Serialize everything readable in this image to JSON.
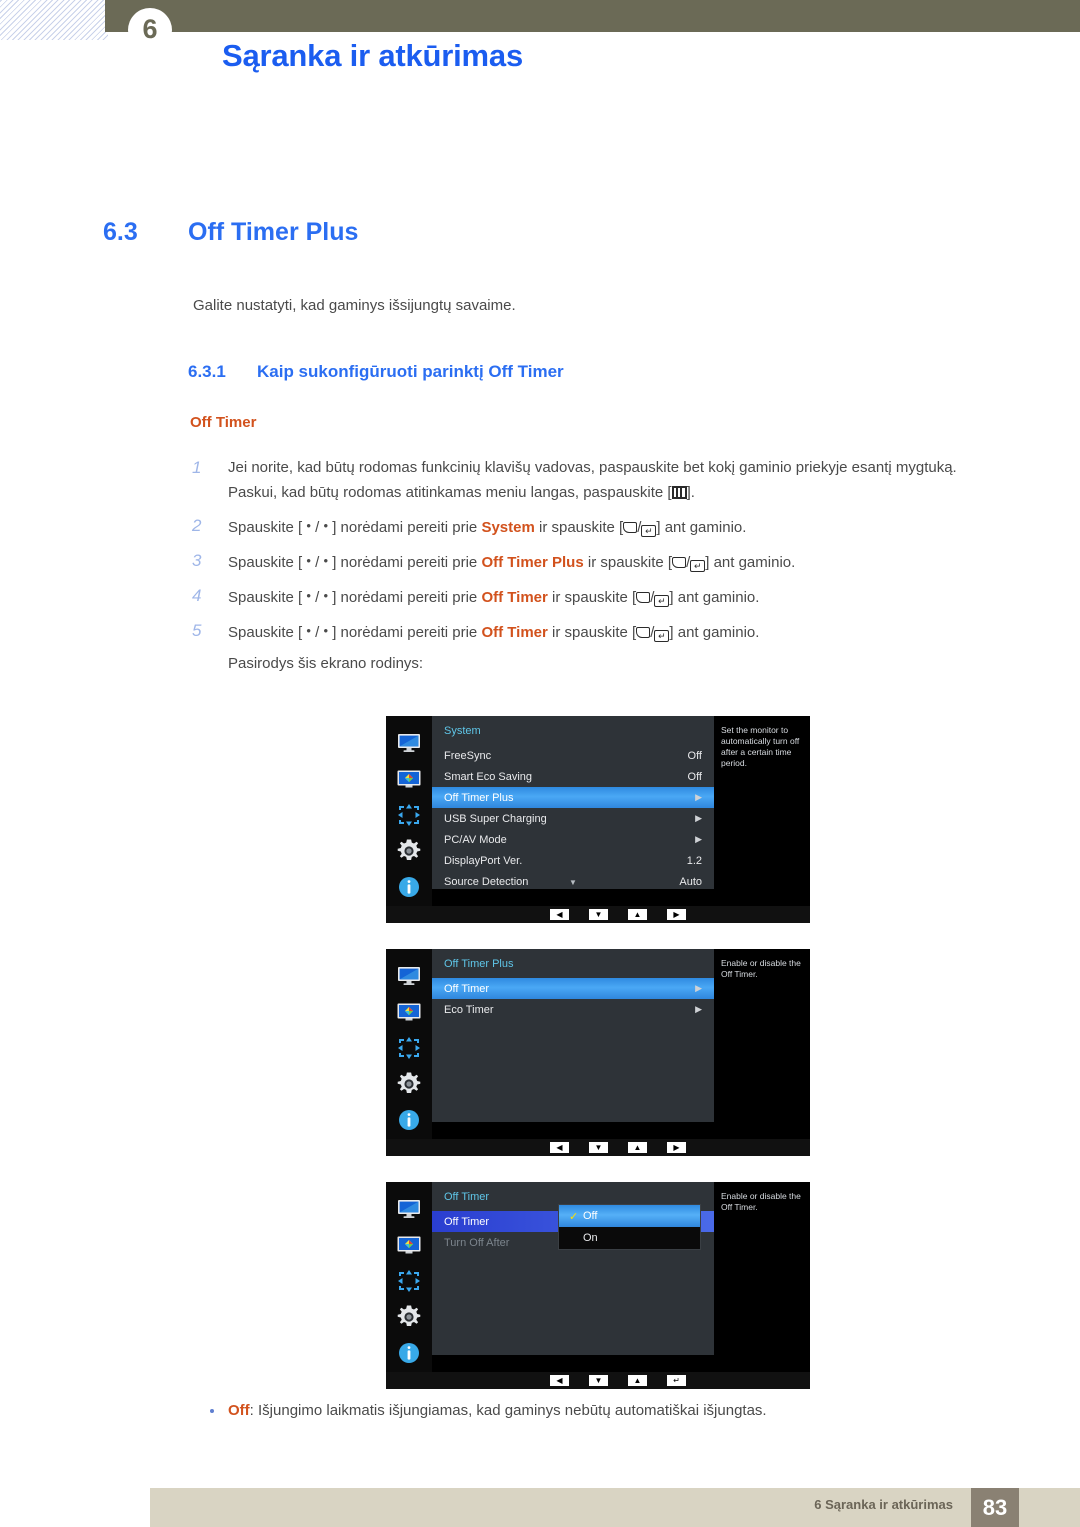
{
  "header": {
    "chapter_number": "6",
    "title": "Sąranka ir atkūrimas"
  },
  "section": {
    "number": "6.3",
    "title": "Off Timer Plus",
    "lead": "Galite nustatyti, kad gaminys išsijungtų savaime."
  },
  "subsection": {
    "number": "6.3.1",
    "title": "Kaip sukonfigūruoti parinktį Off Timer",
    "orange_label": "Off Timer"
  },
  "steps": [
    {
      "num": "1",
      "segments": [
        {
          "t": "Jei norite, kad būtų rodomas funkcinių klavišų vadovas, paspauskite bet kokį gaminio priekyje esantį mygtuką. Paskui, kad būtų rodomas atitinkamas meniu langas, paspauskite [",
          "k": "text"
        },
        {
          "t": "MENU",
          "k": "icon-menu"
        },
        {
          "t": "].",
          "k": "text"
        }
      ]
    },
    {
      "num": "2",
      "segments": [
        {
          "t": "Spauskite [ ",
          "k": "text"
        },
        {
          "t": "•",
          "k": "dot"
        },
        {
          "t": " / ",
          "k": "text"
        },
        {
          "t": "•",
          "k": "dot"
        },
        {
          "t": " ] norėdami pereiti prie ",
          "k": "text"
        },
        {
          "t": "System",
          "k": "hl"
        },
        {
          "t": " ir spauskite [",
          "k": "text"
        },
        {
          "t": "BACK",
          "k": "icon-back"
        },
        {
          "t": "/",
          "k": "text"
        },
        {
          "t": "ENTER",
          "k": "icon-enter"
        },
        {
          "t": "] ant gaminio.",
          "k": "text"
        }
      ]
    },
    {
      "num": "3",
      "segments": [
        {
          "t": "Spauskite [ ",
          "k": "text"
        },
        {
          "t": "•",
          "k": "dot"
        },
        {
          "t": " / ",
          "k": "text"
        },
        {
          "t": "•",
          "k": "dot"
        },
        {
          "t": " ] norėdami pereiti prie ",
          "k": "text"
        },
        {
          "t": "Off Timer Plus",
          "k": "hl"
        },
        {
          "t": " ir spauskite [",
          "k": "text"
        },
        {
          "t": "BACK",
          "k": "icon-back"
        },
        {
          "t": "/",
          "k": "text"
        },
        {
          "t": "ENTER",
          "k": "icon-enter"
        },
        {
          "t": "] ant gaminio.",
          "k": "text"
        }
      ]
    },
    {
      "num": "4",
      "segments": [
        {
          "t": "Spauskite [ ",
          "k": "text"
        },
        {
          "t": "•",
          "k": "dot"
        },
        {
          "t": " / ",
          "k": "text"
        },
        {
          "t": "•",
          "k": "dot"
        },
        {
          "t": " ] norėdami pereiti prie ",
          "k": "text"
        },
        {
          "t": "Off Timer",
          "k": "hl"
        },
        {
          "t": " ir spauskite [",
          "k": "text"
        },
        {
          "t": "BACK",
          "k": "icon-back"
        },
        {
          "t": "/",
          "k": "text"
        },
        {
          "t": "ENTER",
          "k": "icon-enter"
        },
        {
          "t": "] ant gaminio.",
          "k": "text"
        }
      ]
    },
    {
      "num": "5",
      "segments": [
        {
          "t": "Spauskite [ ",
          "k": "text"
        },
        {
          "t": "•",
          "k": "dot"
        },
        {
          "t": " / ",
          "k": "text"
        },
        {
          "t": "•",
          "k": "dot"
        },
        {
          "t": " ] norėdami pereiti prie ",
          "k": "text"
        },
        {
          "t": "Off Timer",
          "k": "hl"
        },
        {
          "t": " ir spauskite [",
          "k": "text"
        },
        {
          "t": "BACK",
          "k": "icon-back"
        },
        {
          "t": "/",
          "k": "text"
        },
        {
          "t": "ENTER",
          "k": "icon-enter"
        },
        {
          "t": "] ant gaminio.",
          "k": "text"
        }
      ]
    }
  ],
  "after_steps": "Pasirodys šis ekrano rodinys:",
  "osd": [
    {
      "id": "osd1",
      "title": "System",
      "help": "Set the monitor to automatically turn off after a certain time period.",
      "rows": [
        {
          "label": "FreeSync",
          "value": "Off",
          "selected": false,
          "dim": false
        },
        {
          "label": "Smart Eco Saving",
          "value": "Off",
          "selected": false,
          "dim": false
        },
        {
          "label": "Off Timer Plus",
          "value": "arrow",
          "selected": true,
          "dim": false
        },
        {
          "label": "USB Super Charging",
          "value": "arrow",
          "selected": false,
          "dim": false
        },
        {
          "label": "PC/AV Mode",
          "value": "arrow",
          "selected": false,
          "dim": false
        },
        {
          "label": "DisplayPort Ver.",
          "value": "1.2",
          "selected": false,
          "dim": false
        },
        {
          "label": "Source Detection",
          "value": "Auto",
          "selected": false,
          "dim": false
        }
      ],
      "has_scroll_down": true,
      "buttons": [
        "◀",
        "▼",
        "▲",
        "▶"
      ]
    },
    {
      "id": "osd2",
      "title": "Off Timer Plus",
      "help": "Enable or disable the Off Timer.",
      "rows": [
        {
          "label": "Off Timer",
          "value": "arrow",
          "selected": true,
          "dim": false
        },
        {
          "label": "Eco Timer",
          "value": "arrow",
          "selected": false,
          "dim": false
        }
      ],
      "has_scroll_down": false,
      "buttons": [
        "◀",
        "▼",
        "▲",
        "▶"
      ]
    },
    {
      "id": "osd3",
      "title": "Off Timer",
      "help": "Enable or disable the Off Timer.",
      "rows": [
        {
          "label": "Off Timer",
          "value": "",
          "selected": true,
          "dim": false
        },
        {
          "label": "Turn Off After",
          "value": "",
          "selected": false,
          "dim": true
        }
      ],
      "popup": [
        {
          "label": "Off",
          "checked": true,
          "selected": true
        },
        {
          "label": "On",
          "checked": false,
          "selected": false
        }
      ],
      "has_scroll_down": false,
      "buttons": [
        "◀",
        "▼",
        "▲",
        "↵"
      ]
    }
  ],
  "rail_icons": [
    "monitor-icon",
    "picture-icon",
    "move-arrows-icon",
    "gear-icon",
    "info-icon"
  ],
  "bullet": {
    "term": "Off",
    "text": ": Išjungimo laikmatis išjungiamas, kad gaminys nebūtų automatiškai išjungtas."
  },
  "footer": {
    "text": "6 Sąranka ir atkūrimas",
    "page": "83"
  },
  "colors": {
    "heading_blue": "#2b6ef2",
    "header_blue": "#1b5df0",
    "orange": "#d2521d",
    "olive": "#6b6a56",
    "footer_bg": "#d9d4c3",
    "page_box": "#8a8173",
    "osd_title": "#5fc6e8",
    "osd_highlight": "#4aa8f5"
  }
}
